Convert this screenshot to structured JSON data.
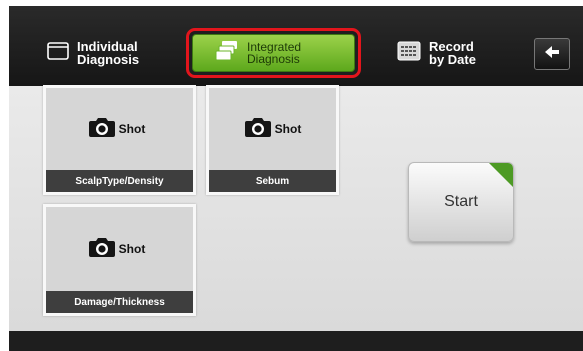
{
  "tabs": {
    "individual": {
      "label": "Individual\nDiagnosis",
      "icon": "window-icon"
    },
    "integrated": {
      "label": "Integrated\nDiagnosis",
      "icon": "stacked-windows-icon",
      "selected": true
    },
    "record": {
      "label": "Record\nby Date",
      "icon": "calendar-grid-icon"
    }
  },
  "back_icon": "arrow-left-icon",
  "cards": [
    {
      "shot_label": "Shot",
      "caption": "ScalpType/Density",
      "icon": "camera-icon"
    },
    {
      "shot_label": "Shot",
      "caption": "Sebum",
      "icon": "camera-icon"
    },
    {
      "shot_label": "Shot",
      "caption": "Damage/Thickness",
      "icon": "camera-icon"
    }
  ],
  "start_label": "Start",
  "colors": {
    "selected_tab": "#7bc033",
    "highlight_border": "#e2151c",
    "start_corner": "#4d9a24"
  }
}
